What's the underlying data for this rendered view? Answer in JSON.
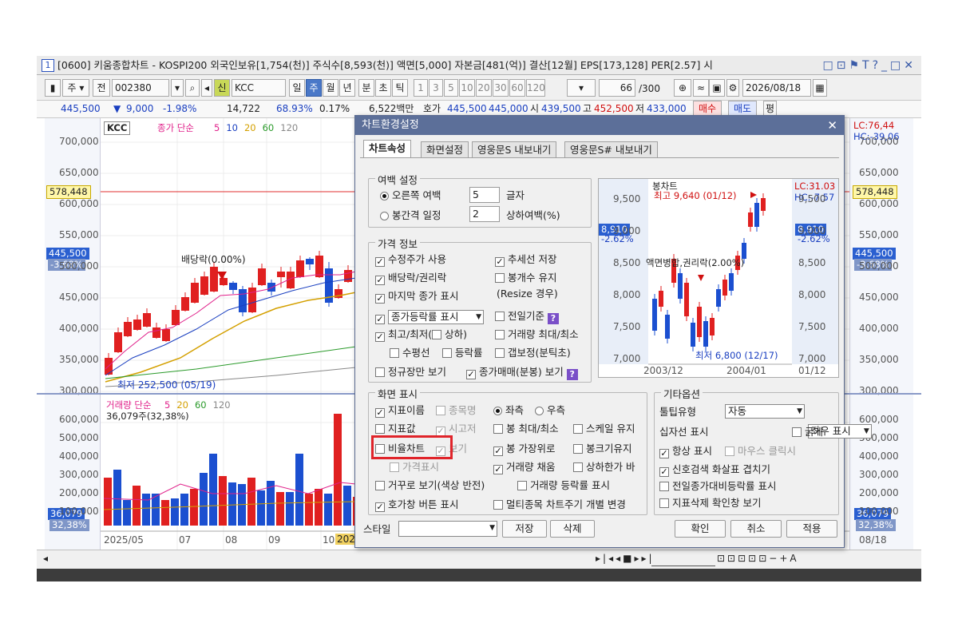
{
  "window": {
    "num": "1",
    "title": "[0600] 키움종합차트 - KOSPI200 외국인보유[1,754(천)] 주식수[8,593(천)] 액면[5,000] 자본금[481(억)] 결산[12월] EPS[173,128] PER[2.57] 시",
    "tools": "□⊡⚑T?_□✕"
  },
  "toolbar": {
    "type_label": "주",
    "prev_label": "전",
    "code": "002380",
    "new_label": "신",
    "stock_name": "KCC",
    "periods": [
      "일",
      "주",
      "월",
      "년",
      "분",
      "초",
      "틱"
    ],
    "active_period": "주",
    "numbers": [
      "1",
      "3",
      "5",
      "10",
      "20",
      "30",
      "60",
      "120"
    ],
    "count": "66",
    "count_max": "/300",
    "date": "2026/08/18"
  },
  "quote": {
    "price": "445,500",
    "change_arrow": "▼",
    "change": "9,000",
    "change_pct": "-1.98%",
    "volume": "14,722",
    "ratio": "68.93%",
    "ratio2": "0.17%",
    "amount": "6,522백만",
    "ask_label": "호가",
    "ask1": "445,500",
    "ask2": "445,000",
    "open_label": "시",
    "open": "439,500",
    "high_label": "고",
    "high": "452,500",
    "low_label": "저",
    "low": "433,000",
    "buy": "매수",
    "sell": "매도",
    "eval": "평"
  },
  "chart": {
    "legend_name": "KCC",
    "legend_price": "종가 단순",
    "ma": [
      "5",
      "10",
      "20",
      "60",
      "120"
    ],
    "ma_colors": [
      "#e0208a",
      "#1a3fc0",
      "#d4a000",
      "#2a9a2a",
      "#888888"
    ],
    "y_ticks": [
      "700,000",
      "650,000",
      "600,000",
      "550,000",
      "500,000",
      "450,000",
      "400,000",
      "350,000",
      "300,000"
    ],
    "ref_price": "578,448",
    "cur_price": "445,500",
    "cur_pct": "-3.68%",
    "annotation_dividend": "배당락(0.00%)",
    "low_label": "최저 252,500 (05/19)",
    "lc": "LC:76,44",
    "hc": "HC:-39,06",
    "vol_legend": "거래량 단순",
    "vol_ma": [
      "5",
      "20",
      "60",
      "120"
    ],
    "vol_info": "36,079주(32,38%)",
    "vol_ticks": [
      "600,000",
      "500,000",
      "400,000",
      "300,000",
      "200,000",
      "100,000"
    ],
    "vol_cur": "36,079",
    "vol_pct": "32,38%",
    "x_labels": [
      "2025/05",
      "07",
      "08",
      "09",
      "10",
      "08/18"
    ],
    "x_cursor": "2025"
  },
  "dialog": {
    "title": "차트환경설정",
    "close": "✕",
    "tabs": [
      "차트속성",
      "화면설정",
      "영웅문S 내보내기",
      "영웅문S# 내보내기"
    ],
    "margin": {
      "title": "여백 설정",
      "right_margin": "오른쪽 여백",
      "right_value": "5",
      "right_unit": "글자",
      "bar_gap": "봉간격 일정",
      "bar_value": "2",
      "bar_unit": "상하여백(%)"
    },
    "price": {
      "title": "가격 정보",
      "adj": "수정주가 사용",
      "trend_save": "추세선 저장",
      "dividend": "배당락/권리락",
      "keep_bars": "봉개수 유지",
      "resize": "(Resize 경우)",
      "last_close": "마지막 종가 표시",
      "change_display": "종가등락률 표시",
      "prev_base": "전일기준",
      "hilo": "최고/최저(",
      "hilo_updown": "상하)",
      "vol_max": "거래량 최대/최소",
      "hline": "수평선",
      "rate": "등락률",
      "gap": "갭보정(분틱초)",
      "regular_only": "정규장만 보기",
      "close_trade": "종가매매(분봉) 보기"
    },
    "screen": {
      "title": "화면 표시",
      "indicator_name": "지표이름",
      "item_name": "종목명",
      "left": "좌측",
      "right": "우측",
      "indicator_value": "지표값",
      "open_high": "시고저",
      "bar_maxmin": "봉 최대/최소",
      "scale_keep": "스케일 유지",
      "ratio_chart": "비율차트",
      "view": "보기",
      "bar_front": "봉 가장위로",
      "bar_size": "봉크기유지",
      "price_display": "가격표시",
      "vol_fill": "거래량 채움",
      "updown_bar": "상하한가 바",
      "inverse": "거꾸로 보기(색상 반전)",
      "vol_rate": "거래량 등락률 표시",
      "hoga_btn": "호가창 버튼 표시",
      "multi": "멀티종목 차트주기 개별 변경"
    },
    "etc": {
      "title": "기타옵션",
      "tooltip_type": "툴팁유형",
      "tooltip_value": "자동",
      "crosshair": "십자선 표시",
      "crosshair_value": "좌우 표시",
      "bold": "굵게",
      "always": "항상 표시",
      "mouse_click": "마우스 클릭시",
      "signal": "신호검색 화살표 겹치기",
      "prev_rate": "전일종가대비등락률 표시",
      "delete_confirm": "지표삭제 확인창 보기"
    },
    "preview": {
      "title": "봉차트",
      "high_label": "최고 9,640 (01/12)",
      "low_label": "최저 6,800 (12/17)",
      "merge_label": "액면병합,권리락(2.00%)",
      "lc": "LC:31.03",
      "hc": "HC:-7.57",
      "cur": "8,910",
      "cur_pct": "-2.62%",
      "y_ticks": [
        "9,500",
        "9,000",
        "8,500",
        "8,000",
        "7,500",
        "7,000"
      ],
      "x_labels": [
        "2003/12",
        "2004/01",
        "01/12"
      ]
    },
    "style_label": "스타일",
    "save": "저장",
    "delete": "삭제",
    "ok": "확인",
    "cancel": "취소",
    "apply": "적용"
  }
}
